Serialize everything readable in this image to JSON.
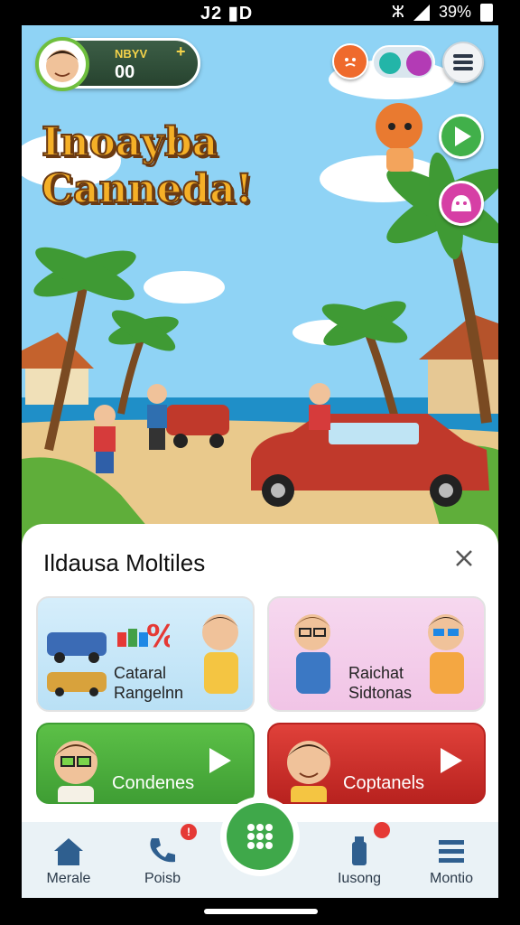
{
  "status_bar": {
    "left_text": "J2 ▮D",
    "signal_text": "ⵣ",
    "battery_text": "39%"
  },
  "header": {
    "player_label": "NBYV",
    "player_plus": "+",
    "player_score": "00"
  },
  "game_title": {
    "line1": "Inoayba",
    "line2": "Canneda!"
  },
  "panel": {
    "title": "Ildausa Moltiles",
    "cards": [
      {
        "line1": "Cataral",
        "line2": "Rangelnn"
      },
      {
        "line1": "Raichat",
        "line2": "Sidtonas"
      }
    ],
    "play_cards": [
      {
        "label": "Condenes"
      },
      {
        "label": "Coptanels"
      }
    ]
  },
  "nav": {
    "items": [
      {
        "label": "Merale",
        "icon": "home-icon"
      },
      {
        "label": "Poisb",
        "icon": "phone-icon",
        "badge": "!"
      },
      {
        "label": "",
        "icon": "grid-icon"
      },
      {
        "label": "Iusong",
        "icon": "bottle-icon"
      },
      {
        "label": "Montio",
        "icon": "menu-icon"
      }
    ]
  },
  "colors": {
    "title_fill": "#f5b027",
    "green": "#3fa84a",
    "red": "#d32f2f",
    "sky": "#8fd3f5"
  }
}
